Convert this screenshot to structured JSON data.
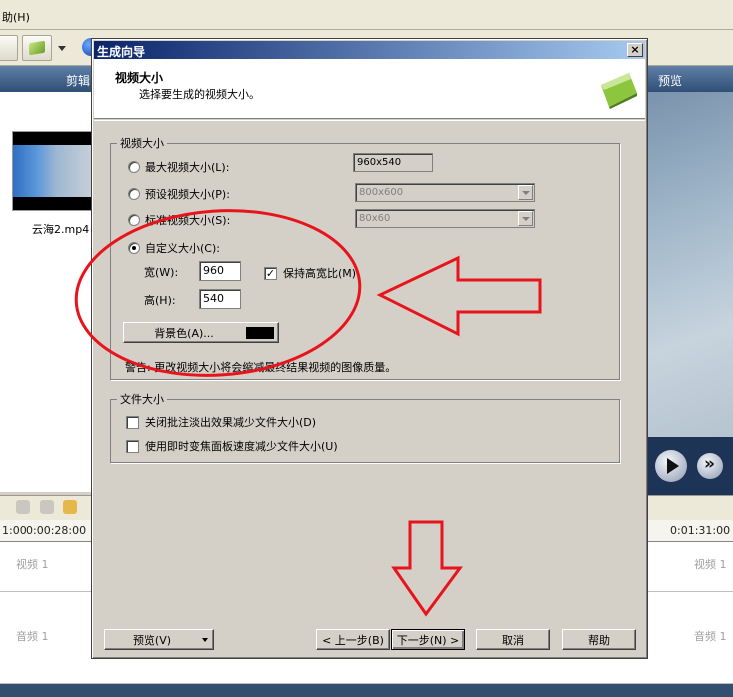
{
  "app": {
    "menu_help": "助(H)",
    "tab_edit": "剪辑",
    "tab_preview": "预览",
    "clip_name": "云海2.mp4",
    "timeline": {
      "ticks": [
        "1:00",
        "0:00:28:00",
        "0:01:31:00"
      ],
      "video_track": "视频 1",
      "audio_track": "音频 1"
    }
  },
  "dialog": {
    "title": "生成向导",
    "close": "×",
    "header_title": "视频大小",
    "header_subtitle": "选择要生成的视频大小。",
    "size_group": {
      "legend": "视频大小",
      "max_label": "最大视频大小(L):",
      "max_value": "960x540",
      "preset_label": "预设视频大小(P):",
      "preset_value": "800x600",
      "standard_label": "标准视频大小(S):",
      "standard_value": "80x60",
      "custom_label": "自定义大小(C):",
      "width_label": "宽(W):",
      "width_value": "960",
      "height_label": "高(H):",
      "height_value": "540",
      "keep_ratio_label": "保持高宽比(M)",
      "keep_ratio_checked": true,
      "background_label": "背景色(A)...",
      "background_color": "#000000",
      "warning": "警告: 更改视频大小将会缩减最终结果视频的图像质量。"
    },
    "file_group": {
      "legend": "文件大小",
      "option1": "关闭批注淡出效果减少文件大小(D)",
      "option2": "使用即时变焦面板速度减少文件大小(U)"
    },
    "buttons": {
      "preview": "预览(V)",
      "back": "< 上一步(B)",
      "next": "下一步(N) >",
      "cancel": "取消",
      "help": "帮助"
    }
  },
  "annotation_color": "#e8141b"
}
